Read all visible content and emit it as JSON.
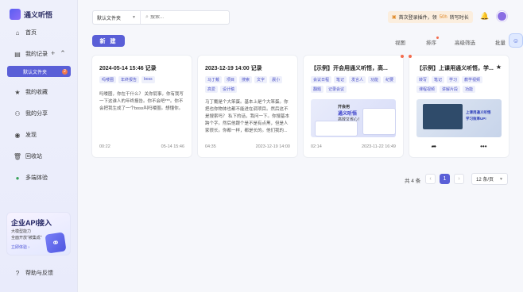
{
  "app": {
    "title": "通义听悟"
  },
  "sidebar": {
    "items": [
      {
        "label": "首页",
        "icon": "home-icon"
      },
      {
        "label": "我的记录",
        "icon": "records-icon"
      },
      {
        "label": "我的收藏",
        "icon": "star-icon"
      },
      {
        "label": "我的分享",
        "icon": "share-icon"
      },
      {
        "label": "发现",
        "icon": "discover-icon"
      },
      {
        "label": "回收站",
        "icon": "trash-icon"
      },
      {
        "label": "多端体验",
        "icon": "multi-device-icon"
      }
    ],
    "sub_item": {
      "label": "默认文件夹",
      "badge": "2"
    },
    "promo": {
      "title": "企业API接入",
      "line1": "大模型能力",
      "line2": "全面开放\"被集成\"",
      "link": "立即体验 ›"
    },
    "help": "帮助与反馈"
  },
  "header": {
    "folder_select": "默认文件夹",
    "search_placeholder": "搜索...",
    "banner": {
      "prefix": "首次登录插件，领",
      "highlight": "50h",
      "suffix": "转写时长"
    }
  },
  "toolbar": {
    "new_label": "新 建",
    "view": "视图",
    "sort": "排序",
    "filter": "高级筛选",
    "batch": "批量"
  },
  "cards": [
    {
      "title": "2024-05-14 15:46 记录",
      "tags": [
        "吗喽圈",
        "年终报告",
        "boss"
      ],
      "desc": "吗喽圈，你在干什么？ 关你屁事，你有我写一下这谁人的年终报告。你不会吧***。你不会把我生成了一个boss叫吗喽圈。想懂你。",
      "duration": "00:22",
      "date": "05-14 15:46"
    },
    {
      "title": "2023-12-19 14:00 记录",
      "tags": [
        "马丁戴",
        "项目",
        "搜索",
        "文字",
        "晨小",
        "高爱",
        "设计稿"
      ],
      "desc": "马丁戴是个大笨蛋。基本上是个大笨蛋。你把也你物体也都不能进在调项目。然后这不是搜索吗？ 私下的话，我问一下。你搜基本跨个字。然后他跟个是不是有点黑，但是人家很长。你都一样，都是长的。他们我的...",
      "duration": "04:35",
      "date": "2023-12-19 14:00"
    },
    {
      "title": "【示例】开会用通义听悟，高...",
      "tags": [
        "会议日程",
        "笔记",
        "发言人",
        "功能",
        "纪要",
        "翻题",
        "记录会议"
      ],
      "thumb_line1": "开会用",
      "thumb_line2": "通义听悟",
      "thumb_line3": "高效又省心！",
      "duration": "02:14",
      "date": "2023-11-22 16:49"
    },
    {
      "title": "【示例】上课用通义听悟，学...",
      "tags": [
        "转写",
        "笔记",
        "学习",
        "教学视频",
        "课程视频",
        "讲解片段",
        "功能"
      ],
      "thumb_line1": "上课用通义听悟",
      "thumb_line2": "学习效率UP!",
      "actions": [
        "share-icon",
        "more-icon"
      ]
    }
  ],
  "pagination": {
    "total": "共 4 条",
    "current": "1",
    "per_page": "12 条/页"
  },
  "colors": {
    "primary": "#5a5fd7",
    "tag_bg": "#eef0fb",
    "tag_text": "#4a50c7",
    "dot": "#f36b4d"
  }
}
